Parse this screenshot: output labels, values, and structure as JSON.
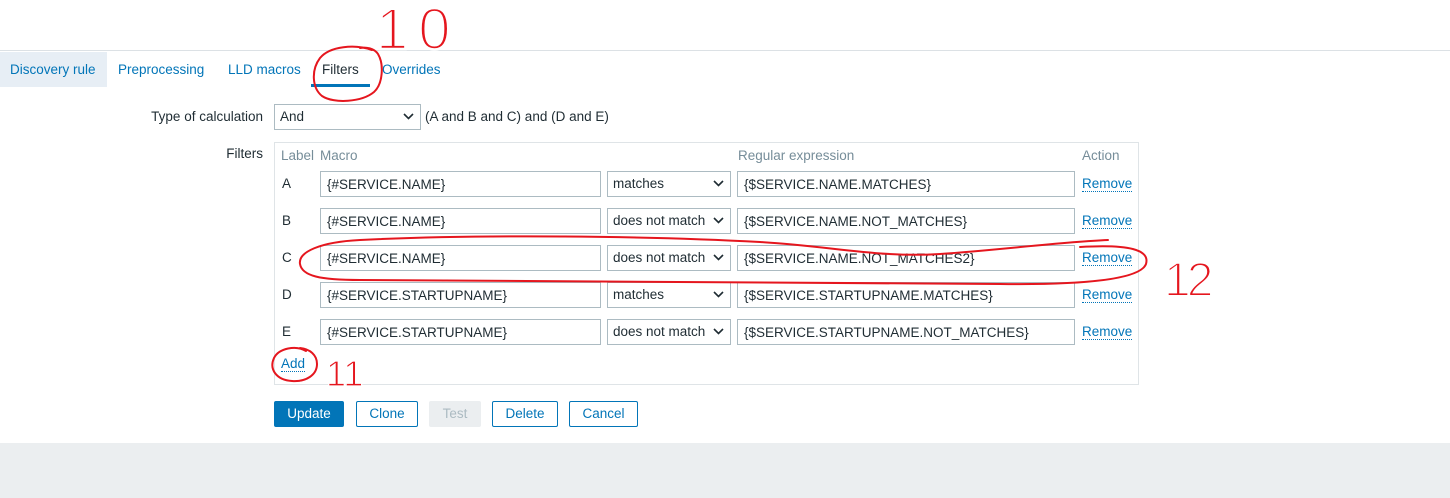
{
  "tabs": [
    {
      "label": "Discovery rule"
    },
    {
      "label": "Preprocessing"
    },
    {
      "label": "LLD macros"
    },
    {
      "label": "Filters",
      "active": true
    },
    {
      "label": "Overrides"
    }
  ],
  "calculation": {
    "label": "Type of calculation",
    "value": "And",
    "expression": "(A and B and C) and (D and E)"
  },
  "filters": {
    "label": "Filters",
    "headers": {
      "label": "Label",
      "macro": "Macro",
      "regex": "Regular expression",
      "action": "Action"
    },
    "rows": [
      {
        "label": "A",
        "macro": "{#SERVICE.NAME}",
        "operator": "matches",
        "regex": "{$SERVICE.NAME.MATCHES}",
        "action": "Remove"
      },
      {
        "label": "B",
        "macro": "{#SERVICE.NAME}",
        "operator": "does not match",
        "regex": "{$SERVICE.NAME.NOT_MATCHES}",
        "action": "Remove"
      },
      {
        "label": "C",
        "macro": "{#SERVICE.NAME}",
        "operator": "does not match",
        "regex": "{$SERVICE.NAME.NOT_MATCHES2}",
        "action": "Remove"
      },
      {
        "label": "D",
        "macro": "{#SERVICE.STARTUPNAME}",
        "operator": "matches",
        "regex": "{$SERVICE.STARTUPNAME.MATCHES}",
        "action": "Remove"
      },
      {
        "label": "E",
        "macro": "{#SERVICE.STARTUPNAME}",
        "operator": "does not match",
        "regex": "{$SERVICE.STARTUPNAME.NOT_MATCHES}",
        "action": "Remove"
      }
    ],
    "add_label": "Add"
  },
  "buttons": {
    "update": {
      "label": "Update"
    },
    "clone": {
      "label": "Clone"
    },
    "test": {
      "label": "Test",
      "disabled": true
    },
    "delete": {
      "label": "Delete"
    },
    "cancel": {
      "label": "Cancel"
    }
  },
  "annotations": {
    "tab_marker": "10",
    "add_marker": "11",
    "row_marker": "12"
  },
  "icons": {
    "select_arrow": "chevron-down-icon"
  },
  "colors": {
    "accent": "#0275b8",
    "text": "#1f2c33",
    "muted": "#768d99",
    "footer": "#ebeef0",
    "annotation": "#e5161e"
  }
}
